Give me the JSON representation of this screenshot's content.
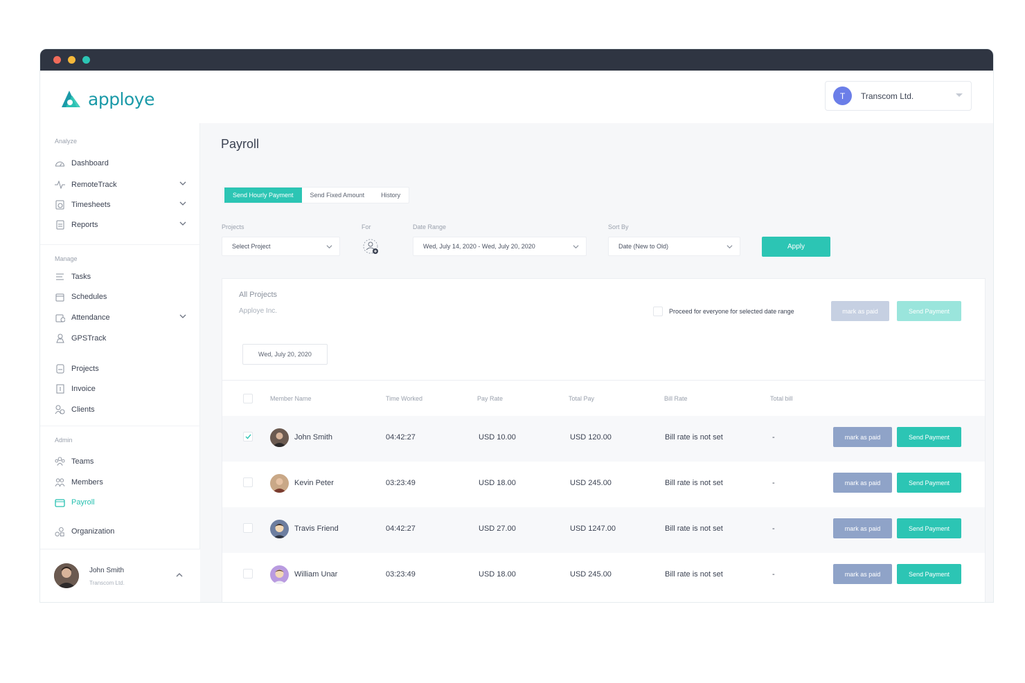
{
  "window": {
    "controls": [
      "close",
      "minimize",
      "maximize"
    ],
    "control_colors": [
      "#f06b5a",
      "#f5b83a",
      "#2cc5b4"
    ]
  },
  "brand": {
    "name": "apploye",
    "color": "#1b9aa8",
    "accent": "#2cc5b4"
  },
  "company_switcher": {
    "initial": "T",
    "name": "Transcom Ltd."
  },
  "sidebar": {
    "analyze_label": "Analyze",
    "analyze": [
      {
        "label": "Dashboard",
        "icon": "dashboard-icon"
      },
      {
        "label": "RemoteTrack",
        "icon": "activity-icon"
      },
      {
        "label": "Timesheets",
        "icon": "timesheet-icon"
      },
      {
        "label": "Reports",
        "icon": "report-icon"
      }
    ],
    "manage_label": "Manage",
    "manage": [
      {
        "label": "Tasks",
        "icon": "tasks-icon"
      },
      {
        "label": "Schedules",
        "icon": "calendar-icon"
      },
      {
        "label": "Attendance",
        "icon": "attendance-icon"
      },
      {
        "label": "GPSTrack",
        "icon": "gps-icon"
      },
      {
        "label": "Projects",
        "icon": "project-icon"
      },
      {
        "label": "Invoice",
        "icon": "invoice-icon"
      },
      {
        "label": "Clients",
        "icon": "clients-icon"
      }
    ],
    "admin_label": "Admin",
    "admin": [
      {
        "label": "Teams",
        "icon": "teams-icon"
      },
      {
        "label": "Members",
        "icon": "members-icon"
      },
      {
        "label": "Payroll",
        "icon": "wallet-icon"
      },
      {
        "label": "Organization",
        "icon": "organization-icon"
      }
    ],
    "user": {
      "name": "John Smith",
      "company": "Transcom Ltd."
    }
  },
  "page": {
    "title": "Payroll",
    "tabs": [
      "Send Hourly Payment",
      "Send Fixed Amount",
      "History"
    ],
    "filters": {
      "projects_label": "Projects",
      "projects_value": "Select Project",
      "for_label": "For",
      "date_label": "Date Range",
      "date_value": "Wed, July 14, 2020 - Wed, July 20, 2020",
      "sort_label": "Sort By",
      "sort_value": "Date (New to Old)",
      "apply": "Apply"
    },
    "card": {
      "title": "All Projects",
      "org": "Apploye Inc.",
      "proceed_label": "Proceed for everyone for selected date range",
      "mark_all": "mark as paid",
      "send_all": "Send Payment",
      "date_chip": "Wed, July 20, 2020"
    },
    "table": {
      "headers": [
        "Member Name",
        "Time Worked",
        "Pay Rate",
        "Total Pay",
        "Bill Rate",
        "Total bill"
      ],
      "rows": [
        {
          "name": "John Smith",
          "time": "04:42:27",
          "rate": "USD 10.00",
          "total": "USD 120.00",
          "bill_rate": "Bill rate is not set",
          "total_bill": "-",
          "checked": true,
          "mark": "mark as paid",
          "send": "Send Payment"
        },
        {
          "name": "Kevin Peter",
          "time": "03:23:49",
          "rate": "USD 18.00",
          "total": "USD 245.00",
          "bill_rate": "Bill rate is not set",
          "total_bill": "-",
          "checked": false,
          "mark": "mark as paid",
          "send": "Send Payment"
        },
        {
          "name": "Travis Friend",
          "time": "04:42:27",
          "rate": "USD 27.00",
          "total": "USD 1247.00",
          "bill_rate": "Bill rate is not set",
          "total_bill": "-",
          "checked": false,
          "mark": "mark as paid",
          "send": "Send Payment"
        },
        {
          "name": "William Unar",
          "time": "03:23:49",
          "rate": "USD 18.00",
          "total": "USD 245.00",
          "bill_rate": "Bill rate is not set",
          "total_bill": "-",
          "checked": false,
          "mark": "mark as paid",
          "send": "Send Payment"
        }
      ]
    }
  }
}
